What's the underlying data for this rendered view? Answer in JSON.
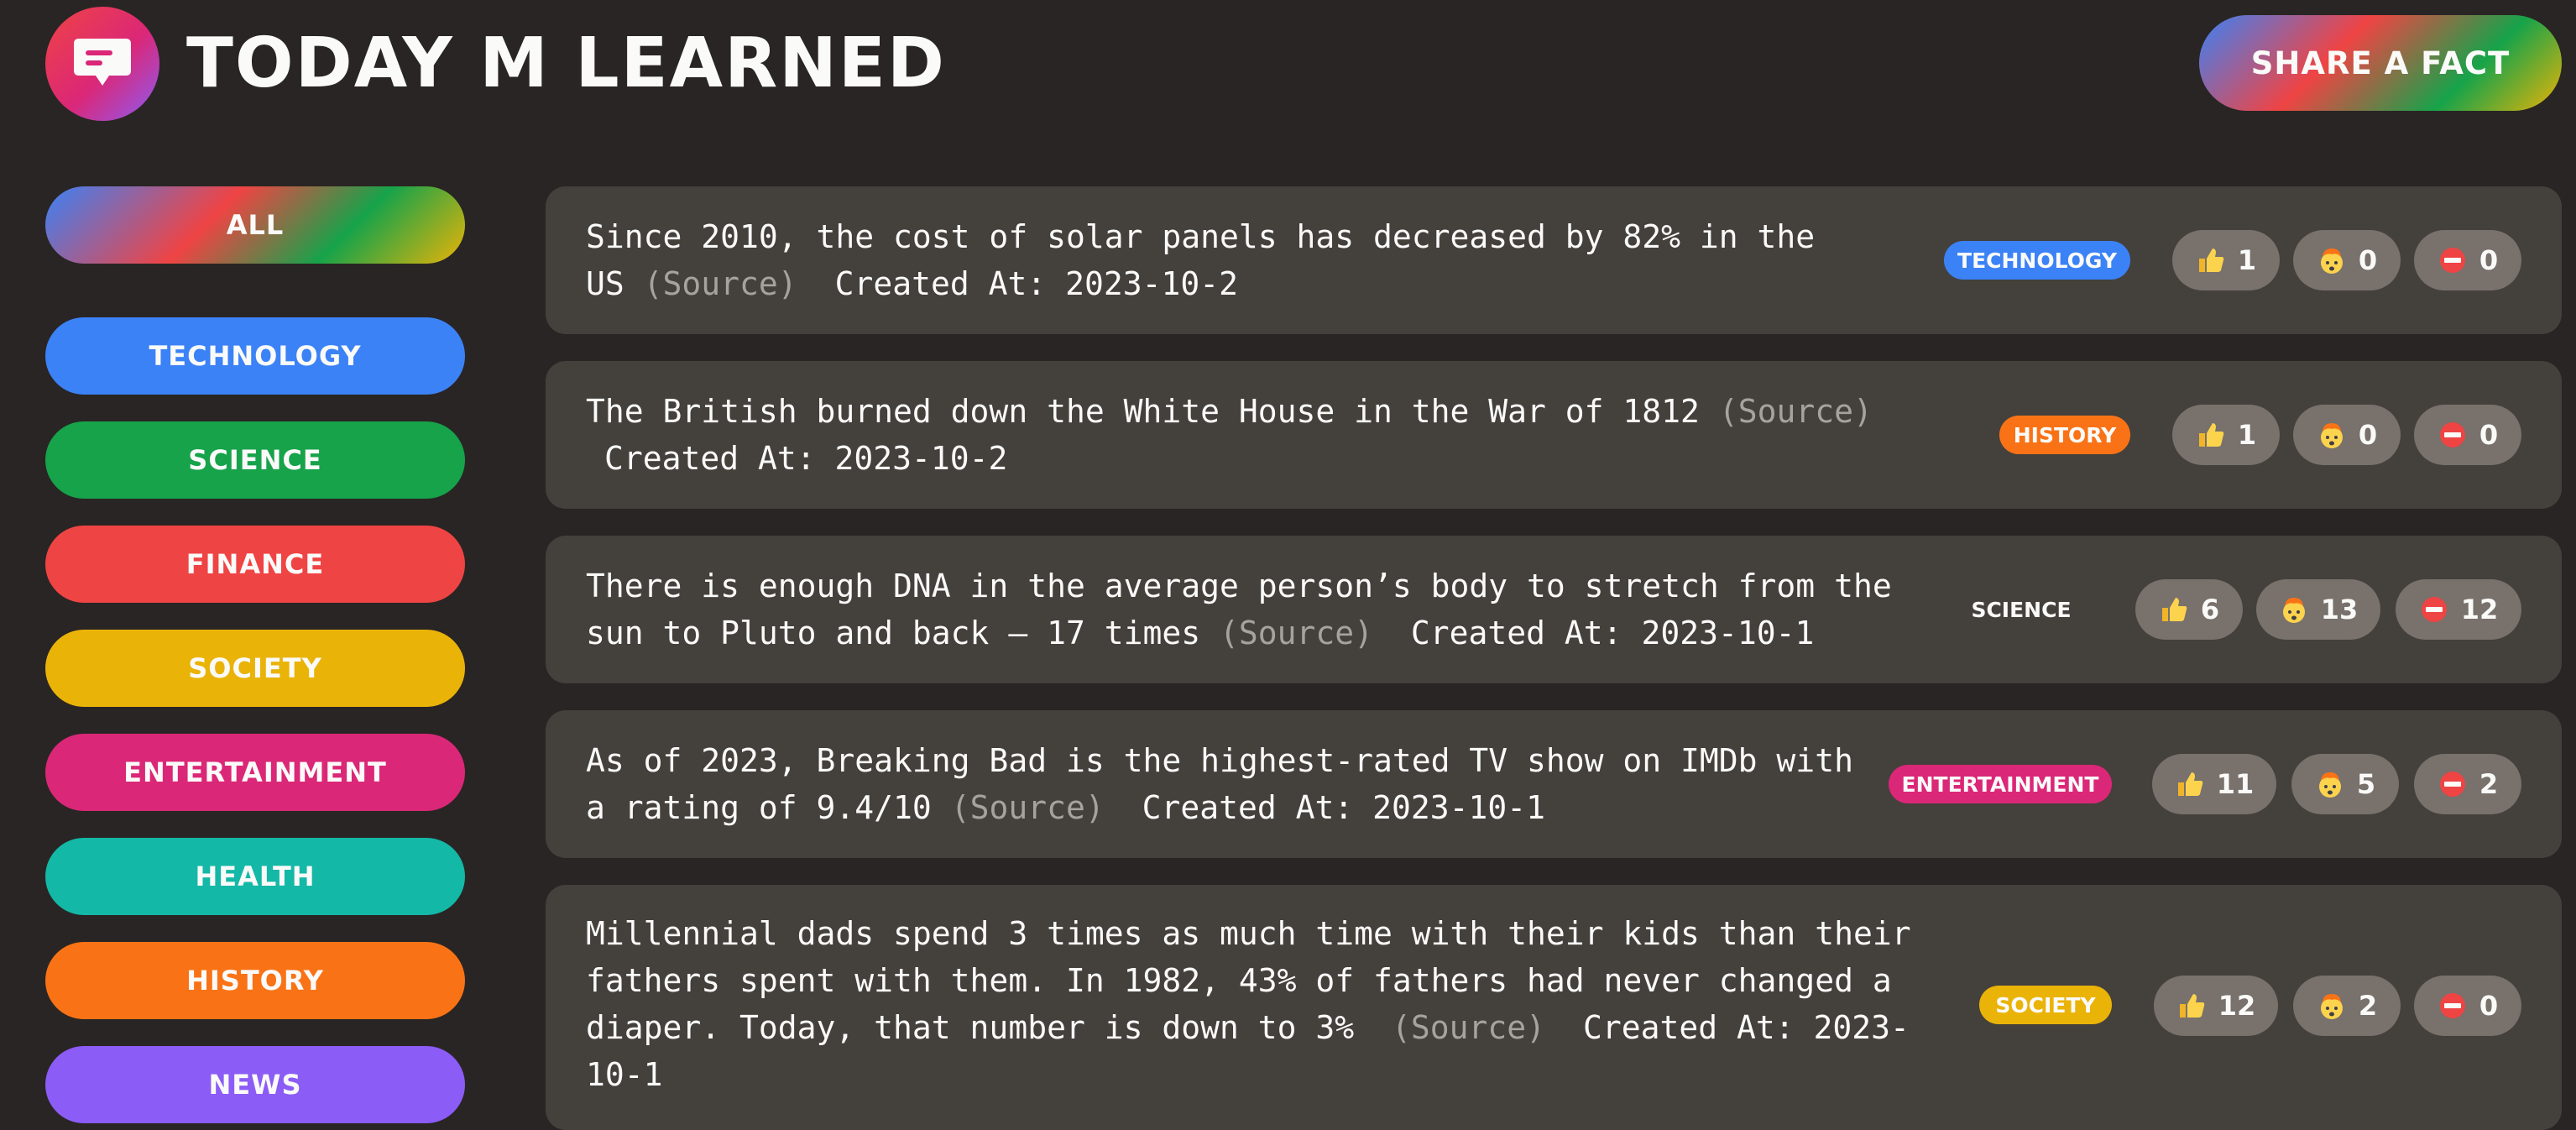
{
  "header": {
    "app_title": "TODAY M LEARNED",
    "share_button_label": "SHARE A FACT",
    "logo_icon": "chat-bubble-icon"
  },
  "sidebar": {
    "categories": [
      {
        "label": "ALL",
        "color": "gradient"
      },
      {
        "label": "TECHNOLOGY",
        "color": "#3b82f6"
      },
      {
        "label": "SCIENCE",
        "color": "#16a34a"
      },
      {
        "label": "FINANCE",
        "color": "#ef4444"
      },
      {
        "label": "SOCIETY",
        "color": "#eab308"
      },
      {
        "label": "ENTERTAINMENT",
        "color": "#db2777"
      },
      {
        "label": "HEALTH",
        "color": "#14b8a6"
      },
      {
        "label": "HISTORY",
        "color": "#f97316"
      },
      {
        "label": "NEWS",
        "color": "#8b5cf6"
      }
    ]
  },
  "vote_icons": [
    "thumbs-up-icon",
    "mind-blown-icon",
    "no-entry-icon"
  ],
  "facts": [
    {
      "text_lines": [
        "Since 2010, the cost of solar panels has decreased by 82% in the",
        "US"
      ],
      "source_label": "(Source)",
      "created_at": "Created At: 2023-10-2",
      "tag": "TECHNOLOGY",
      "tag_color": "#3b82f6",
      "votes": {
        "interesting": "1",
        "mindblowing": "0",
        "false": "0"
      }
    },
    {
      "text_lines": [
        "The British burned down the White House in the War of 1812"
      ],
      "source_label": "(Source)",
      "created_at": "Created At: 2023-10-2",
      "tag": "HISTORY",
      "tag_color": "#f97316",
      "votes": {
        "interesting": "1",
        "mindblowing": "0",
        "false": "0"
      }
    },
    {
      "text_lines": [
        "There is enough DNA in the average person’s body to stretch from the",
        "sun to Pluto and back — 17 times"
      ],
      "source_label": "(Source)",
      "created_at": "Created At: 2023-10-1",
      "tag": "SCIENCE",
      "tag_color": "#44403c",
      "votes": {
        "interesting": "6",
        "mindblowing": "13",
        "false": "12"
      }
    },
    {
      "text_lines": [
        "As of 2023, Breaking Bad is the highest-rated TV show on IMDb with",
        "a rating of 9.4/10"
      ],
      "source_label": "(Source)",
      "created_at": "Created At: 2023-10-1",
      "tag": "ENTERTAINMENT",
      "tag_color": "#db2777",
      "votes": {
        "interesting": "11",
        "mindblowing": "5",
        "false": "2"
      }
    },
    {
      "text_lines": [
        "Millennial dads spend 3 times as much time with their kids than their",
        "fathers spent with them. In 1982, 43% of fathers had never changed a",
        "diaper. Today, that number is down to 3%"
      ],
      "source_label": "(Source)",
      "created_at_lines": [
        "Created At: 2023-",
        "10-1"
      ],
      "tag": "SOCIETY",
      "tag_color": "#eab308",
      "votes": {
        "interesting": "12",
        "mindblowing": "2",
        "false": "0"
      }
    }
  ]
}
